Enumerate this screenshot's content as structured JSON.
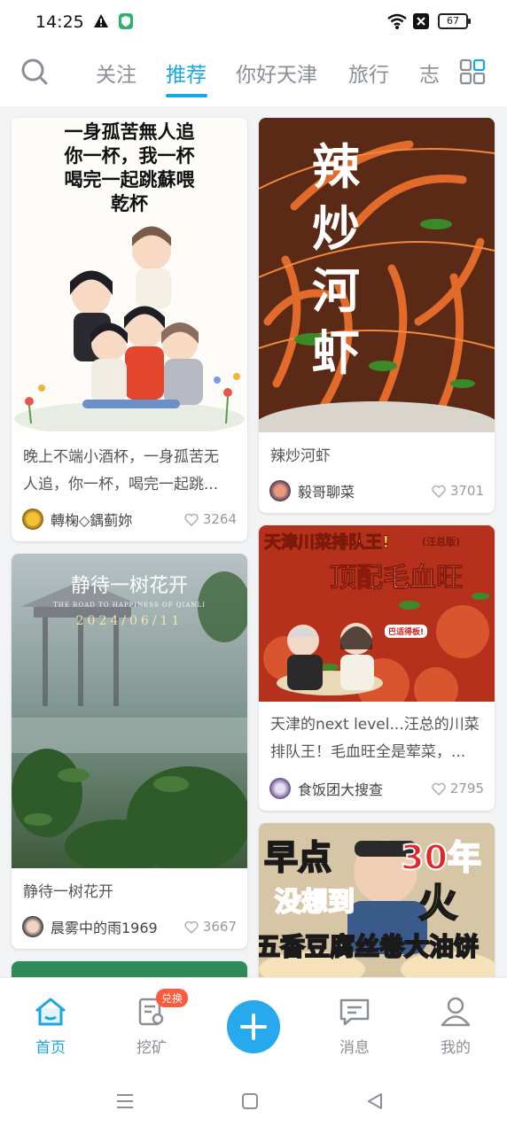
{
  "status": {
    "time": "14:25",
    "battery": "67"
  },
  "tabs": [
    {
      "label": "关注",
      "active": false
    },
    {
      "label": "推荐",
      "active": true
    },
    {
      "label": "你好天津",
      "active": false
    },
    {
      "label": "旅行",
      "active": false
    },
    {
      "label": "志",
      "active": false
    }
  ],
  "cards": [
    {
      "overlay": "一身孤苦無人追\n你一杯，我一杯\n喝完一起跳蘇喂\n乾杯",
      "title_lines": [
        "晚上不端小酒杯，一身孤苦无",
        "人追，你一杯，喝完一起跳..."
      ],
      "author": "轉椈◇鍝蓟妳",
      "likes": "3264"
    },
    {
      "overlay": "辣炒河虾",
      "title_lines": [
        "辣炒河虾"
      ],
      "author": "毅哥聊菜",
      "likes": "3701"
    },
    {
      "overlay": "静待一树花开",
      "overlay_sub": "THE ROAD TO HAPPINESS OF QIANLI",
      "overlay_date": "2024/06/11",
      "title_lines": [
        "静待一树花开"
      ],
      "author": "晨雾中的雨1969",
      "likes": "3667"
    },
    {
      "overlay_top": "天津川菜排队王!",
      "overlay_tag": "(汪总版)",
      "overlay_main": "顶配毛血旺",
      "overlay_small": "巴适得板!",
      "title_lines": [
        "天津的next level...汪总的川菜",
        "排队王！毛血旺全是荤菜，..."
      ],
      "author": "食饭团大搜查",
      "likes": "2795"
    },
    {
      "overlay_a": "早点",
      "overlay_b": "30年",
      "overlay_c": "没想到",
      "overlay_d": "火",
      "overlay_e": "五香豆腐丝卷大油饼"
    }
  ],
  "bottom_nav": [
    {
      "label": "首页",
      "active": true,
      "icon": "home-icon"
    },
    {
      "label": "挖矿",
      "active": false,
      "icon": "mining-icon",
      "badge": "兑换"
    },
    {
      "label": "消息",
      "active": false,
      "icon": "message-icon"
    },
    {
      "label": "我的",
      "active": false,
      "icon": "profile-icon"
    }
  ],
  "colors": {
    "accent": "#19a6e6",
    "badge": "#ff5a3c"
  }
}
